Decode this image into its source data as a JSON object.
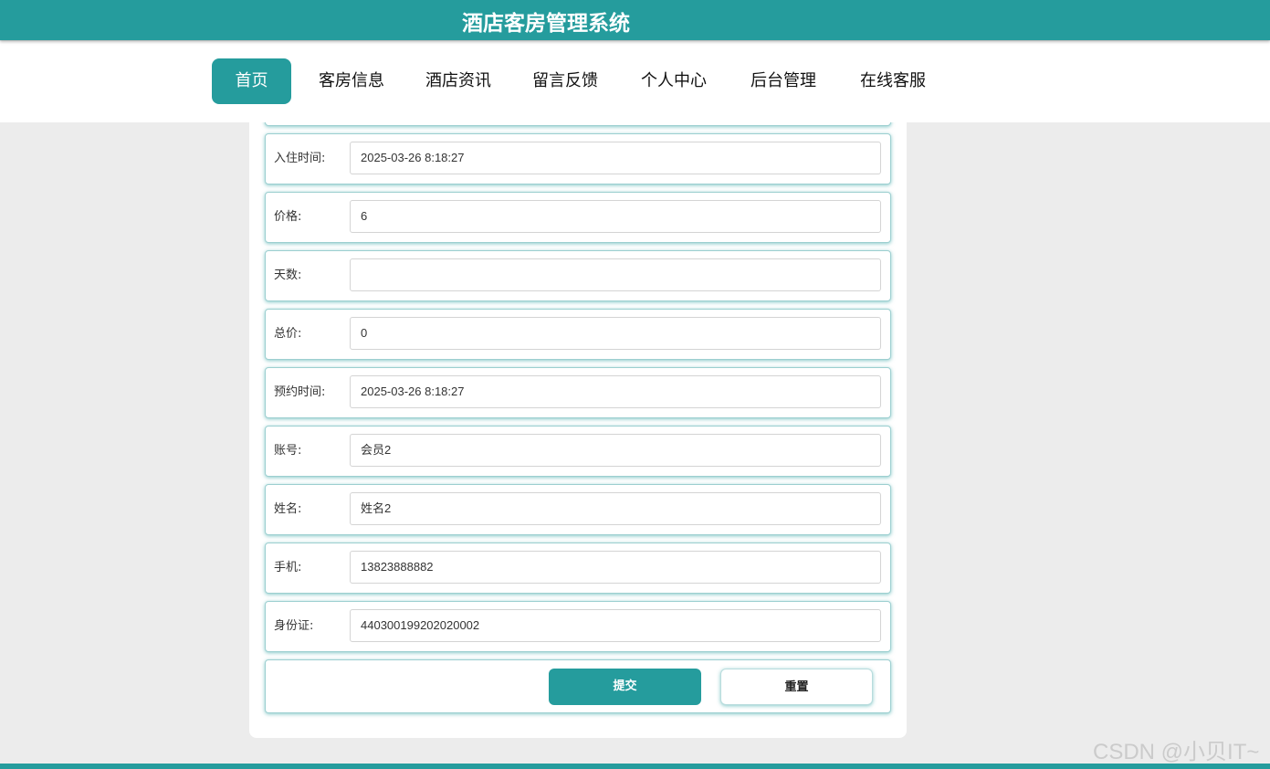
{
  "header": {
    "title": "酒店客房管理系统"
  },
  "nav": {
    "items": [
      {
        "label": "首页",
        "active": true
      },
      {
        "label": "客房信息"
      },
      {
        "label": "酒店资讯"
      },
      {
        "label": "留言反馈"
      },
      {
        "label": "个人中心"
      },
      {
        "label": "后台管理"
      },
      {
        "label": "在线客服"
      }
    ]
  },
  "form": {
    "fields": [
      {
        "label": "入住时间:",
        "value": "2025-03-26 8:18:27"
      },
      {
        "label": "价格:",
        "value": "6"
      },
      {
        "label": "天数:",
        "value": ""
      },
      {
        "label": "总价:",
        "value": "0"
      },
      {
        "label": "预约时间:",
        "value": "2025-03-26 8:18:27"
      },
      {
        "label": "账号:",
        "value": "会员2"
      },
      {
        "label": "姓名:",
        "value": "姓名2"
      },
      {
        "label": "手机:",
        "value": "13823888882"
      },
      {
        "label": "身份证:",
        "value": "440300199202020002"
      }
    ],
    "submit_label": "提交",
    "reset_label": "重置"
  },
  "watermark": "CSDN @小贝IT~",
  "colors": {
    "accent": "#259c9d",
    "page_bg": "#ececec"
  }
}
